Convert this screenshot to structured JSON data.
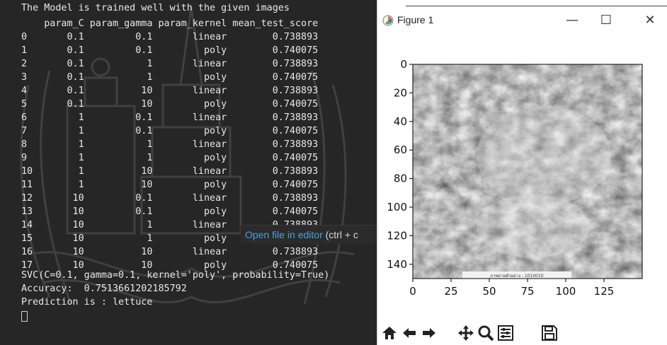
{
  "terminal": {
    "top_line": "The Model is trained well with the given images",
    "header": {
      "c0": "",
      "c1": "param_C",
      "c2": "param_gamma",
      "c3": "param_kernel",
      "c4": "mean_test_score"
    },
    "rows": [
      [
        "0",
        "0.1",
        "0.1",
        "linear",
        "0.738893"
      ],
      [
        "1",
        "0.1",
        "0.1",
        "poly",
        "0.740075"
      ],
      [
        "2",
        "0.1",
        "1",
        "linear",
        "0.738893"
      ],
      [
        "3",
        "0.1",
        "1",
        "poly",
        "0.740075"
      ],
      [
        "4",
        "0.1",
        "10",
        "linear",
        "0.738893"
      ],
      [
        "5",
        "0.1",
        "10",
        "poly",
        "0.740075"
      ],
      [
        "6",
        "1",
        "0.1",
        "linear",
        "0.738893"
      ],
      [
        "7",
        "1",
        "0.1",
        "poly",
        "0.740075"
      ],
      [
        "8",
        "1",
        "1",
        "linear",
        "0.738893"
      ],
      [
        "9",
        "1",
        "1",
        "poly",
        "0.740075"
      ],
      [
        "10",
        "1",
        "10",
        "linear",
        "0.738893"
      ],
      [
        "11",
        "1",
        "10",
        "poly",
        "0.740075"
      ],
      [
        "12",
        "10",
        "0.1",
        "linear",
        "0.738893"
      ],
      [
        "13",
        "10",
        "0.1",
        "poly",
        "0.740075"
      ],
      [
        "14",
        "10",
        "1",
        "linear",
        "0.738893"
      ],
      [
        "15",
        "10",
        "1",
        "poly",
        "0.740075"
      ],
      [
        "16",
        "10",
        "10",
        "linear",
        "0.738893"
      ],
      [
        "17",
        "10",
        "10",
        "poly",
        "0.740075"
      ]
    ],
    "model_line": "SVC(C=0.1, gamma=0.1, kernel='poly', probability=True)",
    "accuracy_line": "Accuracy:  0.7513661202185792",
    "prediction_line": "Prediction is : lettuce",
    "tooltip": {
      "link": "Open file in editor",
      "hint": " (ctrl + c"
    }
  },
  "figure": {
    "title": "Figure 1",
    "min": "—",
    "max": "☐",
    "close": "✕",
    "y_ticks": [
      "0",
      "20",
      "40",
      "60",
      "80",
      "100",
      "120",
      "140"
    ],
    "x_ticks": [
      "0",
      "25",
      "50",
      "75",
      "100",
      "125"
    ],
    "image_caption": "ภาพถ่ายตัวอย่าง - 1010010",
    "toolbar": [
      "home-icon",
      "back-icon",
      "forward-icon",
      "pan-icon",
      "zoom-icon",
      "configure-icon",
      "save-icon"
    ]
  }
}
